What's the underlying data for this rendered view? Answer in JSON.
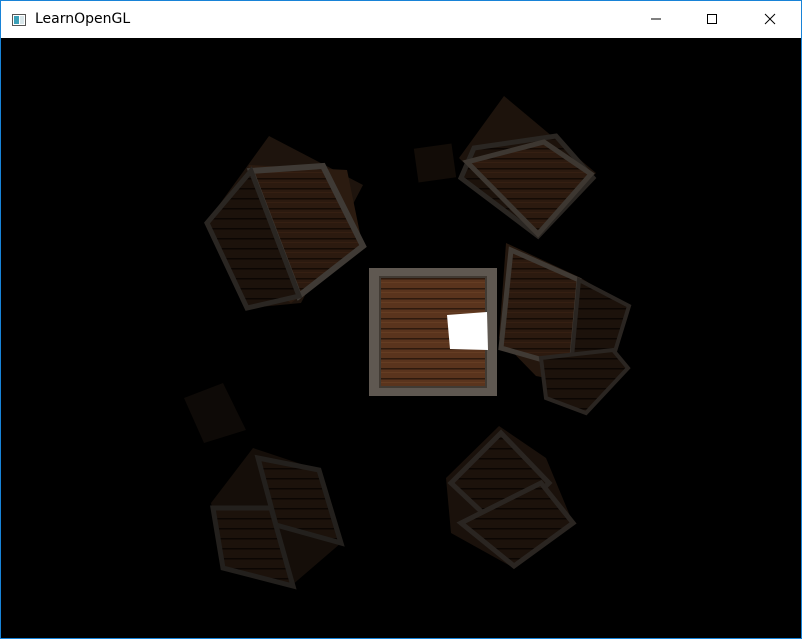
{
  "window": {
    "title": "LearnOpenGL",
    "border_color": "#1883d7",
    "controls": {
      "minimize_icon": "minimize-icon",
      "maximize_icon": "maximize-icon",
      "close_icon": "close-icon"
    }
  },
  "scene": {
    "background": "#000000",
    "light_color": "#ffffff",
    "crate_wood_color": "#6a3f22",
    "crate_frame_color": "#5d564f"
  }
}
